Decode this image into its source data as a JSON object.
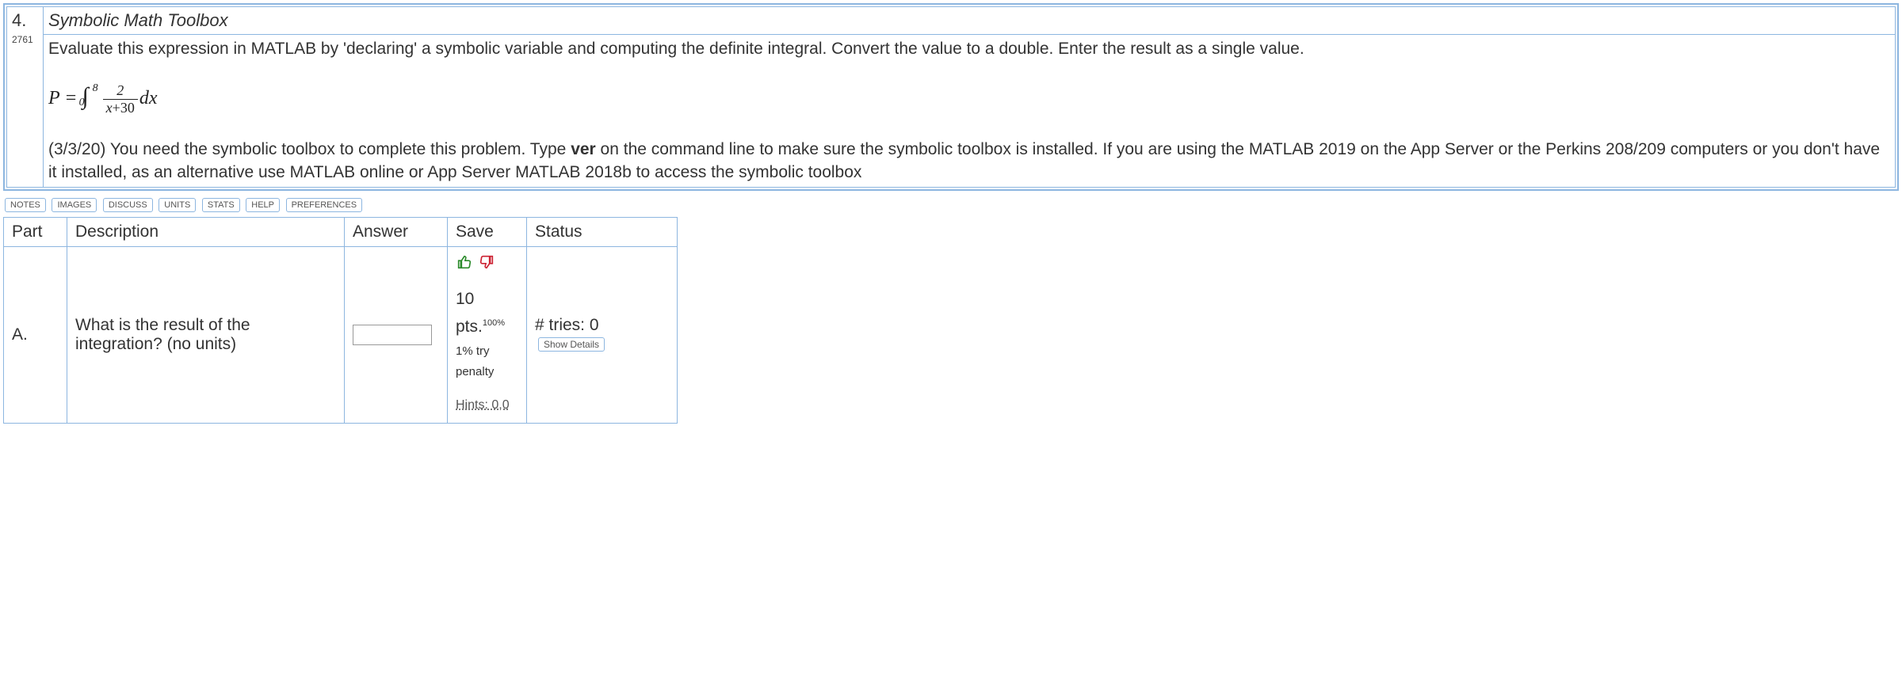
{
  "question": {
    "number": "4.",
    "id": "2761",
    "title": "Symbolic Math Toolbox",
    "prompt": "Evaluate this expression in MATLAB by 'declaring' a symbolic variable and computing the definite integral. Convert the value to a double. Enter the result as a single value.",
    "formula": {
      "lhs": "P",
      "eq": " = ",
      "int_lower": "0",
      "int_upper": "8",
      "frac_num": "2",
      "frac_den_pre": "x",
      "frac_den_op": "+",
      "frac_den_post": "30",
      "dx": "dx"
    },
    "note_pre": "(3/3/20) You need the symbolic toolbox to complete this problem. Type ",
    "note_bold": "ver",
    "note_post": " on the command line to make sure the symbolic toolbox is installed. If you are using the MATLAB 2019 on the App Server or the Perkins 208/209 computers or you don't have it installed, as an alternative use MATLAB online or App Server MATLAB 2018b to access the symbolic toolbox"
  },
  "tabs": {
    "notes": "NOTES",
    "images": "IMAGES",
    "discuss": "DISCUSS",
    "units": "UNITS",
    "stats": "STATS",
    "help": "HELP",
    "prefs": "PREFERENCES"
  },
  "answer_table": {
    "headers": {
      "part": "Part",
      "desc": "Description",
      "answer": "Answer",
      "save": "Save",
      "status": "Status"
    },
    "rows": [
      {
        "part": "A.",
        "desc": "What is the result of the integration? (no units)",
        "answer_value": "",
        "save": {
          "pts_label": "10 pts.",
          "pts_pct": "100%",
          "penalty": "1% try penalty",
          "hints": "Hints: 0,0"
        },
        "status": {
          "tries_label": "# tries: 0",
          "details_btn": "Show Details"
        }
      }
    ]
  }
}
